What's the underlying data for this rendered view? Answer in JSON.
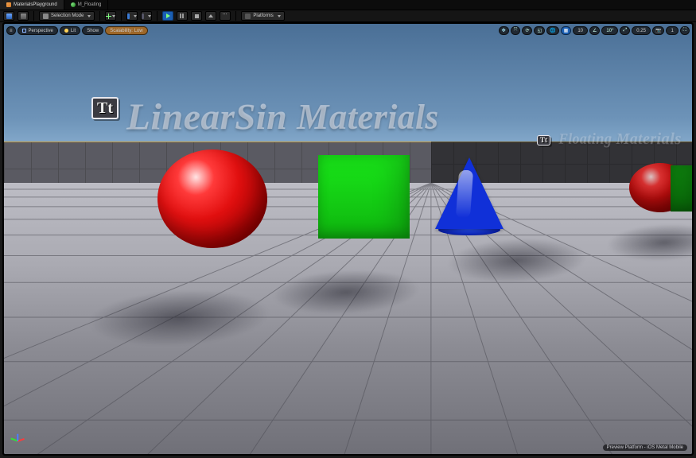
{
  "tabs": [
    {
      "label": "MaterialsPlayground",
      "icon": "level",
      "active": true
    },
    {
      "label": "M_Floating",
      "icon": "mat",
      "active": false
    }
  ],
  "toolbar": {
    "selection_mode": "Selection Mode",
    "platforms": "Platforms"
  },
  "viewport_toolbar_left": {
    "menu": "≡",
    "perspective": "Perspective",
    "lit": "Lit",
    "show": "Show",
    "scalability": "Scalability: Low"
  },
  "viewport_toolbar_right": {
    "snap_angle": "10",
    "snap_scale": "0.25",
    "cam_speed": "1"
  },
  "world_text": {
    "label_main": "LinearSin Materials",
    "label_secondary": "Floating Materials",
    "tt_text": "Tt"
  },
  "platform_hint": "Preview Platform - iOS Metal Mobile"
}
